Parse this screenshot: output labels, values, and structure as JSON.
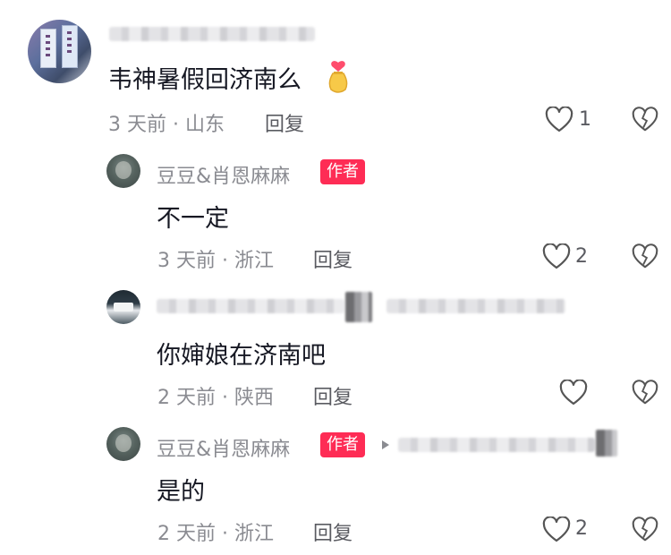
{
  "comments": [
    {
      "text": "韦神暑假回济南么",
      "meta": "3 天前 · 山东",
      "reply_label": "回复",
      "like_count": "1"
    },
    {
      "username": "豆豆&肖恩麻麻",
      "badge": "作者",
      "text": "不一定",
      "meta": "3 天前 · 浙江",
      "reply_label": "回复",
      "like_count": "2"
    },
    {
      "text": "你婶娘在济南吧",
      "meta": "2 天前 · 陕西",
      "reply_label": "回复",
      "like_count": ""
    },
    {
      "username": "豆豆&肖恩麻麻",
      "badge": "作者",
      "text": "是的",
      "meta": "2 天前 · 浙江",
      "reply_label": "回复",
      "like_count": "2"
    }
  ],
  "colors": {
    "badge": "#fe2c55",
    "meta_text": "#8a8b91",
    "body_text": "#161823"
  },
  "icons": [
    "heart-outline-icon",
    "broken-heart-icon",
    "money-bag-emoji",
    "triangle-separator-icon"
  ]
}
